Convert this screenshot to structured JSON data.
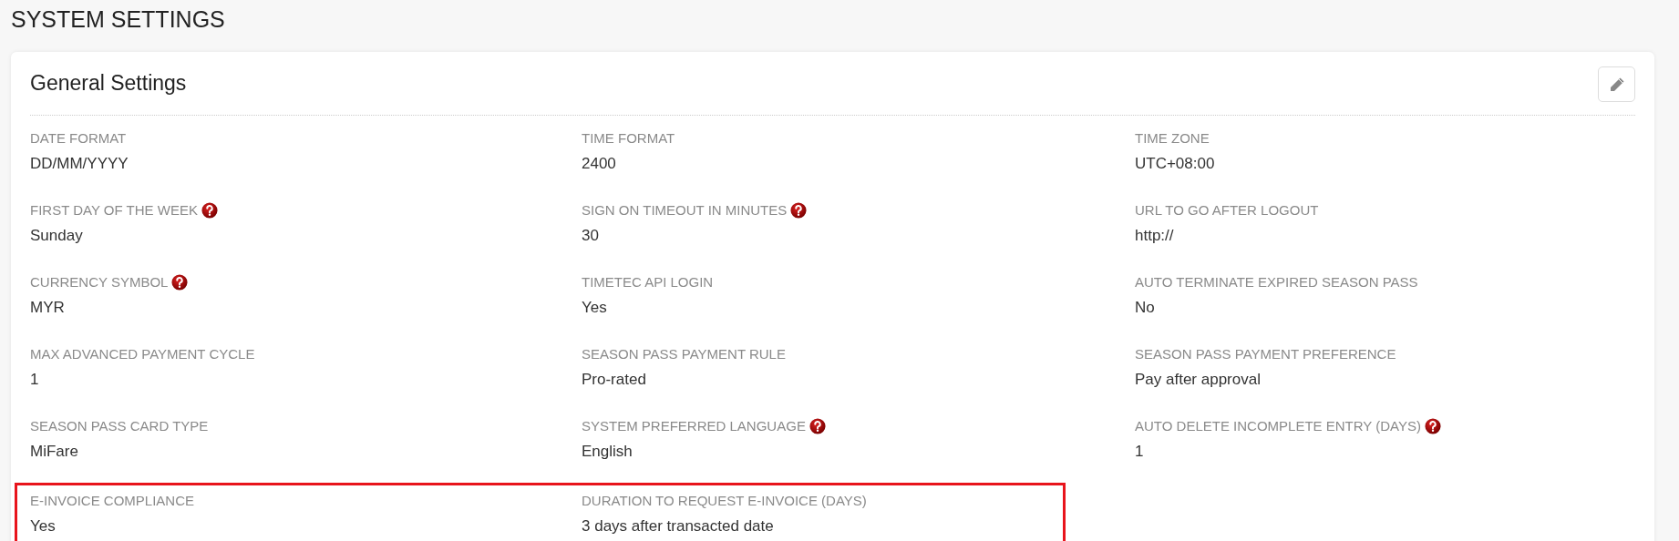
{
  "page_title": "SYSTEM SETTINGS",
  "card": {
    "title": "General Settings",
    "rows": [
      {
        "highlighted": false,
        "fields": [
          {
            "label": "DATE FORMAT",
            "value": "DD/MM/YYYY",
            "help": false
          },
          {
            "label": "TIME FORMAT",
            "value": "2400",
            "help": false
          },
          {
            "label": "TIME ZONE",
            "value": "UTC+08:00",
            "help": false
          }
        ]
      },
      {
        "highlighted": false,
        "fields": [
          {
            "label": "FIRST DAY OF THE WEEK",
            "value": "Sunday",
            "help": true
          },
          {
            "label": "SIGN ON TIMEOUT IN MINUTES",
            "value": "30",
            "help": true
          },
          {
            "label": "URL TO GO AFTER LOGOUT",
            "value": "http://",
            "help": false
          }
        ]
      },
      {
        "highlighted": false,
        "fields": [
          {
            "label": "CURRENCY SYMBOL",
            "value": "MYR",
            "help": true
          },
          {
            "label": "TIMETEC API LOGIN",
            "value": "Yes",
            "help": false
          },
          {
            "label": "AUTO TERMINATE EXPIRED SEASON PASS",
            "value": "No",
            "help": false
          }
        ]
      },
      {
        "highlighted": false,
        "fields": [
          {
            "label": "MAX ADVANCED PAYMENT CYCLE",
            "value": "1",
            "help": false
          },
          {
            "label": "SEASON PASS PAYMENT RULE",
            "value": "Pro-rated",
            "help": false
          },
          {
            "label": "SEASON PASS PAYMENT PREFERENCE",
            "value": "Pay after approval",
            "help": false
          }
        ]
      },
      {
        "highlighted": false,
        "fields": [
          {
            "label": "SEASON PASS CARD TYPE",
            "value": "MiFare",
            "help": false
          },
          {
            "label": "SYSTEM PREFERRED LANGUAGE",
            "value": "English",
            "help": true
          },
          {
            "label": "AUTO DELETE INCOMPLETE ENTRY (DAYS)",
            "value": "1",
            "help": true
          }
        ]
      },
      {
        "highlighted": true,
        "fields": [
          {
            "label": "E-INVOICE COMPLIANCE",
            "value": "Yes",
            "help": false
          },
          {
            "label": "DURATION TO REQUEST E-INVOICE (DAYS)",
            "value": "3 days after transacted date",
            "help": false
          }
        ]
      }
    ]
  }
}
